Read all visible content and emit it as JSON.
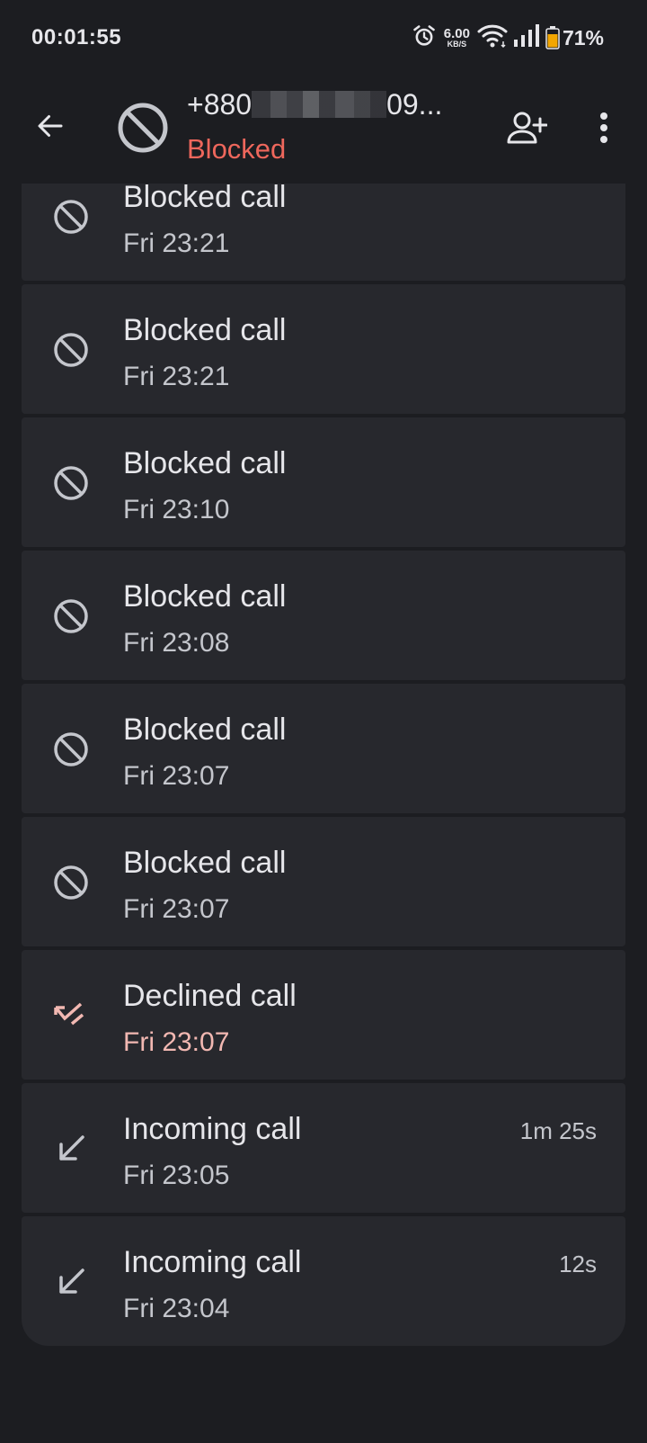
{
  "status_bar": {
    "time": "00:01:55",
    "net_speed_value": "6.00",
    "net_speed_unit": "KB/S",
    "battery_pct": "71%",
    "battery_color": "#f2a600"
  },
  "header": {
    "number_prefix": "+880",
    "number_suffix": "09...",
    "status": "Blocked",
    "status_color": "#ee675c"
  },
  "calls": [
    {
      "type": "Blocked call",
      "time": "Fri 23:21",
      "duration": "",
      "icon": "block-icon"
    },
    {
      "type": "Blocked call",
      "time": "Fri 23:21",
      "duration": "",
      "icon": "block-icon"
    },
    {
      "type": "Blocked call",
      "time": "Fri 23:10",
      "duration": "",
      "icon": "block-icon"
    },
    {
      "type": "Blocked call",
      "time": "Fri 23:08",
      "duration": "",
      "icon": "block-icon"
    },
    {
      "type": "Blocked call",
      "time": "Fri 23:07",
      "duration": "",
      "icon": "block-icon"
    },
    {
      "type": "Blocked call",
      "time": "Fri 23:07",
      "duration": "",
      "icon": "block-icon"
    },
    {
      "type": "Declined call",
      "time": "Fri 23:07",
      "duration": "",
      "icon": "declined-call-icon"
    },
    {
      "type": "Incoming call",
      "time": "Fri 23:05",
      "duration": "1m 25s",
      "icon": "incoming-call-icon"
    },
    {
      "type": "Incoming call",
      "time": "Fri 23:04",
      "duration": "12s",
      "icon": "incoming-call-icon"
    }
  ]
}
